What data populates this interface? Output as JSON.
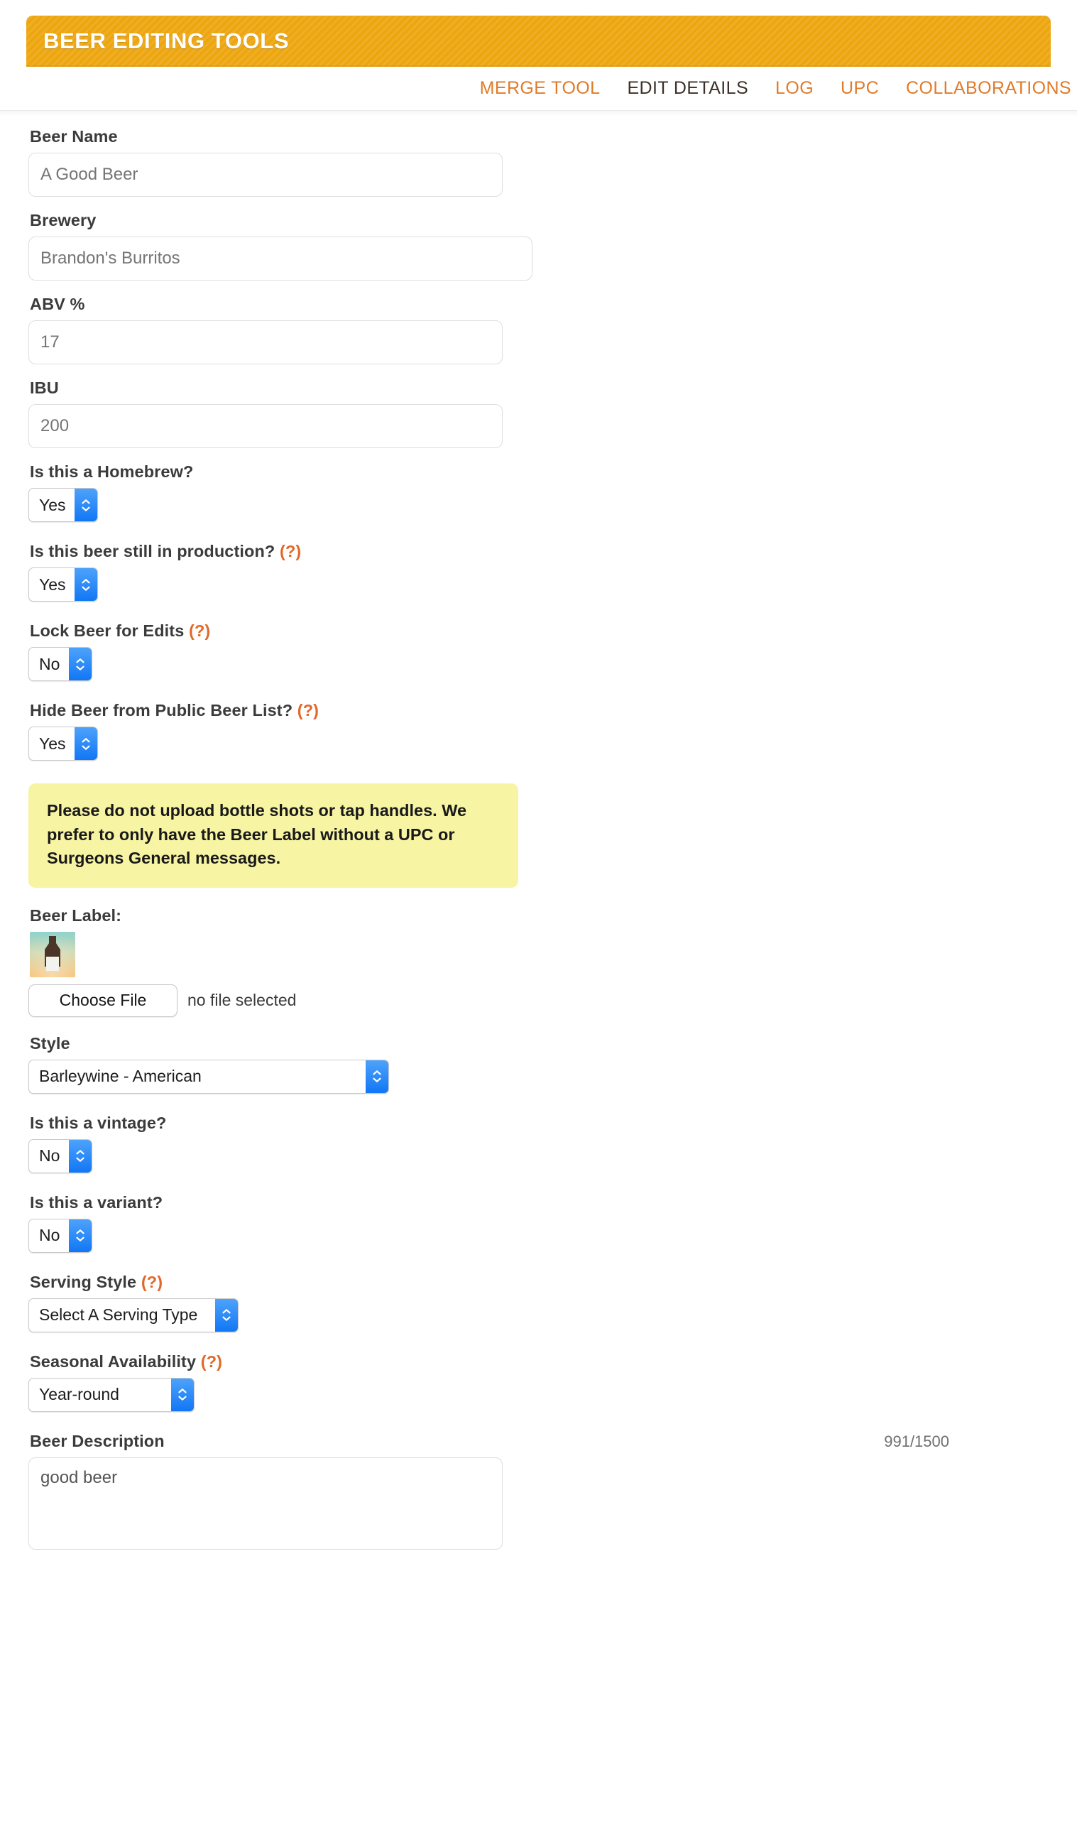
{
  "header": {
    "title": "BEER EDITING TOOLS",
    "accent_color": "#eda610",
    "link_color": "#e07b2a"
  },
  "tabs": [
    {
      "label": "MERGE TOOL",
      "active": false
    },
    {
      "label": "EDIT DETAILS",
      "active": true
    },
    {
      "label": "LOG",
      "active": false
    },
    {
      "label": "UPC",
      "active": false
    },
    {
      "label": "COLLABORATIONS",
      "active": false
    }
  ],
  "form": {
    "beer_name": {
      "label": "Beer Name",
      "value": "A Good Beer",
      "placeholder": "A Good Beer"
    },
    "brewery": {
      "label": "Brewery",
      "value": "Brandon's Burritos",
      "placeholder": "Brandon's Burritos"
    },
    "abv": {
      "label": "ABV %",
      "value": "17",
      "placeholder": "17"
    },
    "ibu": {
      "label": "IBU",
      "value": "200",
      "placeholder": "200"
    },
    "homebrew": {
      "label": "Is this a Homebrew?",
      "value": "Yes",
      "options": [
        "Yes",
        "No"
      ]
    },
    "in_production": {
      "label": "Is this beer still in production?",
      "help": "(?)",
      "value": "Yes",
      "options": [
        "Yes",
        "No"
      ]
    },
    "lock_edits": {
      "label": "Lock Beer for Edits",
      "help": "(?)",
      "value": "No",
      "options": [
        "Yes",
        "No"
      ]
    },
    "hide_from_list": {
      "label": "Hide Beer from Public Beer List?",
      "help": "(?)",
      "value": "Yes",
      "options": [
        "Yes",
        "No"
      ]
    },
    "notice": "Please do not upload bottle shots or tap handles. We prefer to only have the Beer Label without a UPC or Surgeons General messages.",
    "beer_label": {
      "label": "Beer Label:",
      "thumbnail_icon": "beer-bottle-placeholder",
      "choose_file_label": "Choose File",
      "file_status": "no file selected"
    },
    "style": {
      "label": "Style",
      "value": "Barleywine - American"
    },
    "vintage": {
      "label": "Is this a vintage?",
      "value": "No",
      "options": [
        "Yes",
        "No"
      ]
    },
    "variant": {
      "label": "Is this a variant?",
      "value": "No",
      "options": [
        "Yes",
        "No"
      ]
    },
    "serving_style": {
      "label": "Serving Style",
      "help": "(?)",
      "value": "Select A Serving Type"
    },
    "seasonal": {
      "label": "Seasonal Availability",
      "help": "(?)",
      "value": "Year-round"
    },
    "description": {
      "label": "Beer Description",
      "counter": "991/1500",
      "value": "good beer"
    }
  }
}
